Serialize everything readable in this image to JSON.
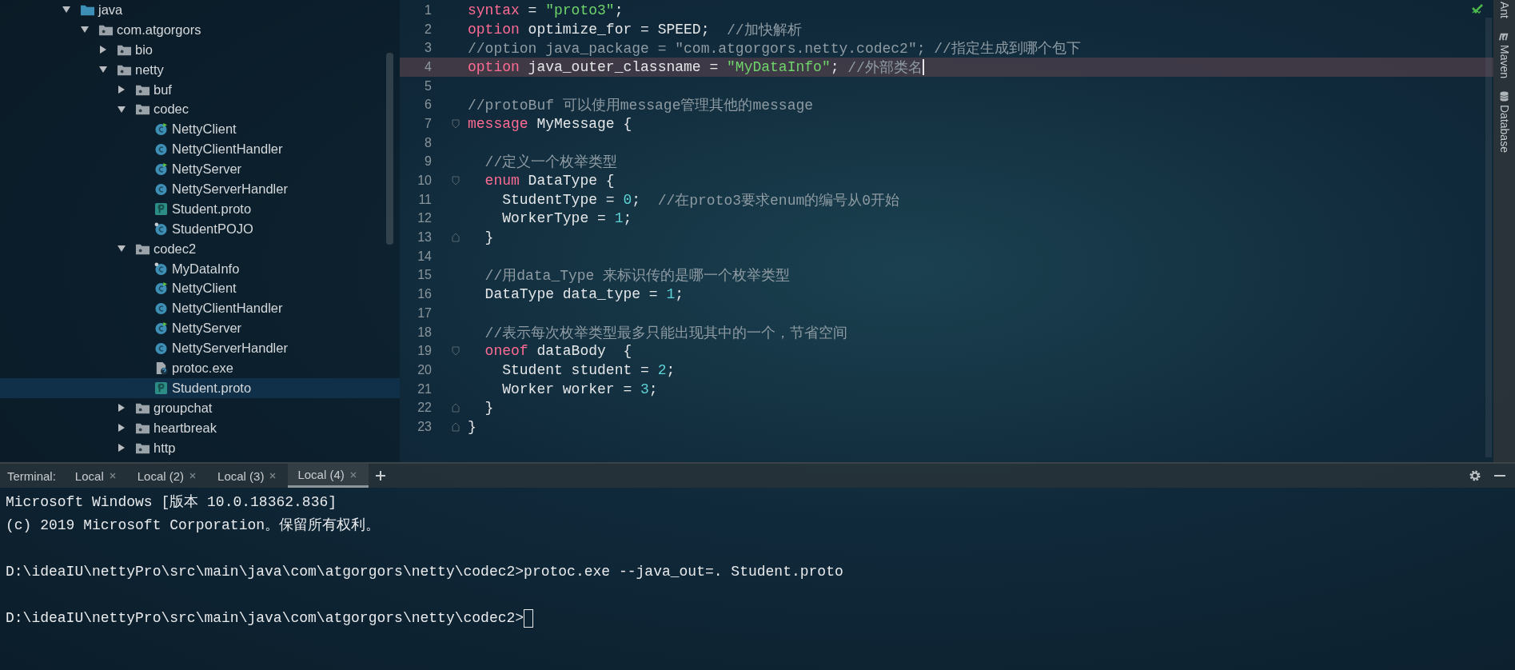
{
  "project_tree": [
    {
      "label": "java",
      "kind": "source-folder",
      "expanded": true,
      "selected": false,
      "children": [
        {
          "label": "com.atgorgors",
          "kind": "package",
          "expanded": true,
          "selected": false,
          "children": [
            {
              "label": "bio",
              "kind": "package",
              "expanded": false,
              "selected": false
            },
            {
              "label": "netty",
              "kind": "package",
              "expanded": true,
              "selected": false,
              "children": [
                {
                  "label": "buf",
                  "kind": "package",
                  "expanded": false,
                  "selected": false
                },
                {
                  "label": "codec",
                  "kind": "package",
                  "expanded": true,
                  "selected": false,
                  "children": [
                    {
                      "label": "NettyClient",
                      "kind": "runnable-class",
                      "selected": false
                    },
                    {
                      "label": "NettyClientHandler",
                      "kind": "class",
                      "selected": false
                    },
                    {
                      "label": "NettyServer",
                      "kind": "runnable-class",
                      "selected": false
                    },
                    {
                      "label": "NettyServerHandler",
                      "kind": "class",
                      "selected": false
                    },
                    {
                      "label": "Student.proto",
                      "kind": "proto",
                      "selected": false
                    },
                    {
                      "label": "StudentPOJO",
                      "kind": "generated-class",
                      "selected": false
                    }
                  ]
                },
                {
                  "label": "codec2",
                  "kind": "package",
                  "expanded": true,
                  "selected": false,
                  "children": [
                    {
                      "label": "MyDataInfo",
                      "kind": "generated-class",
                      "selected": false
                    },
                    {
                      "label": "NettyClient",
                      "kind": "runnable-class",
                      "selected": false
                    },
                    {
                      "label": "NettyClientHandler",
                      "kind": "class",
                      "selected": false
                    },
                    {
                      "label": "NettyServer",
                      "kind": "runnable-class",
                      "selected": false
                    },
                    {
                      "label": "NettyServerHandler",
                      "kind": "class",
                      "selected": false
                    },
                    {
                      "label": "protoc.exe",
                      "kind": "unknown-file",
                      "selected": false
                    },
                    {
                      "label": "Student.proto",
                      "kind": "proto",
                      "selected": true
                    }
                  ]
                },
                {
                  "label": "groupchat",
                  "kind": "package",
                  "expanded": false,
                  "selected": false
                },
                {
                  "label": "heartbreak",
                  "kind": "package",
                  "expanded": false,
                  "selected": false
                },
                {
                  "label": "http",
                  "kind": "package",
                  "expanded": false,
                  "selected": false
                }
              ]
            }
          ]
        }
      ]
    }
  ],
  "editor": {
    "lines": [
      {
        "number": "1",
        "current": false,
        "tokens": [
          {
            "kind": "keyword",
            "text": "syntax"
          },
          {
            "kind": "plain",
            "text": " = "
          },
          {
            "kind": "string",
            "text": "\"proto3\""
          },
          {
            "kind": "plain",
            "text": ";"
          }
        ]
      },
      {
        "number": "2",
        "current": false,
        "tokens": [
          {
            "kind": "keyword",
            "text": "option"
          },
          {
            "kind": "plain",
            "text": " optimize_for = SPEED;  "
          },
          {
            "kind": "comment",
            "text": "//加快解析"
          }
        ]
      },
      {
        "number": "3",
        "current": false,
        "tokens": [
          {
            "kind": "comment",
            "text": "//option java_package = \"com.atgorgors.netty.codec2\"; //指定生成到哪个包下"
          }
        ]
      },
      {
        "number": "4",
        "current": true,
        "tokens": [
          {
            "kind": "keyword",
            "text": "option"
          },
          {
            "kind": "plain",
            "text": " java_outer_classname = "
          },
          {
            "kind": "string",
            "text": "\"MyDataInfo\""
          },
          {
            "kind": "plain",
            "text": "; "
          },
          {
            "kind": "comment",
            "text": "//外部类名"
          }
        ]
      },
      {
        "number": "5",
        "current": false
      },
      {
        "number": "6",
        "current": false,
        "tokens": [
          {
            "kind": "comment",
            "text": "//protoBuf 可以使用message管理其他的message"
          }
        ]
      },
      {
        "number": "7",
        "current": false,
        "fold_start": true,
        "tokens": [
          {
            "kind": "keyword",
            "text": "message"
          },
          {
            "kind": "plain",
            "text": " MyMessage {"
          }
        ]
      },
      {
        "number": "8",
        "current": false
      },
      {
        "number": "9",
        "current": false,
        "tokens": [
          {
            "kind": "comment",
            "text": "  //定义一个枚举类型"
          }
        ]
      },
      {
        "number": "10",
        "current": false,
        "fold_start": true,
        "nested": true,
        "tokens": [
          {
            "kind": "keyword",
            "text": "enum"
          },
          {
            "kind": "plain",
            "text": " DataType {"
          }
        ]
      },
      {
        "number": "11",
        "current": false,
        "tokens": [
          {
            "kind": "plain",
            "text": "    StudentType = "
          },
          {
            "kind": "number",
            "text": "0"
          },
          {
            "kind": "plain",
            "text": ";  "
          },
          {
            "kind": "comment",
            "text": "//在proto3要求enum的编号从0开始"
          }
        ]
      },
      {
        "number": "12",
        "current": false,
        "tokens": [
          {
            "kind": "plain",
            "text": "    WorkerType = "
          },
          {
            "kind": "number",
            "text": "1"
          },
          {
            "kind": "plain",
            "text": ";"
          }
        ]
      },
      {
        "number": "13",
        "current": false,
        "fold_end": true,
        "tokens": [
          {
            "kind": "plain",
            "text": "  }"
          }
        ]
      },
      {
        "number": "14",
        "current": false
      },
      {
        "number": "15",
        "current": false,
        "tokens": [
          {
            "kind": "comment",
            "text": "  //用data_Type 来标识传的是哪一个枚举类型"
          }
        ]
      },
      {
        "number": "16",
        "current": false,
        "tokens": [
          {
            "kind": "plain",
            "text": "  DataType data_type = "
          },
          {
            "kind": "number",
            "text": "1"
          },
          {
            "kind": "plain",
            "text": ";"
          }
        ]
      },
      {
        "number": "17",
        "current": false
      },
      {
        "number": "18",
        "current": false,
        "tokens": [
          {
            "kind": "comment",
            "text": "  //表示每次枚举类型最多只能出现其中的一个，节省空间"
          }
        ]
      },
      {
        "number": "19",
        "current": false,
        "fold_start": true,
        "nested": true,
        "tokens": [
          {
            "kind": "keyword",
            "text": "oneof"
          },
          {
            "kind": "plain",
            "text": " dataBody  {"
          }
        ]
      },
      {
        "number": "20",
        "current": false,
        "tokens": [
          {
            "kind": "plain",
            "text": "    Student student = "
          },
          {
            "kind": "number",
            "text": "2"
          },
          {
            "kind": "plain",
            "text": ";"
          }
        ]
      },
      {
        "number": "21",
        "current": false,
        "tokens": [
          {
            "kind": "plain",
            "text": "    Worker worker = "
          },
          {
            "kind": "number",
            "text": "3"
          },
          {
            "kind": "plain",
            "text": ";"
          }
        ]
      },
      {
        "number": "22",
        "current": false,
        "fold_end": true,
        "tokens": [
          {
            "kind": "plain",
            "text": "  }"
          }
        ]
      },
      {
        "number": "23",
        "current": false,
        "fold_end": true,
        "tokens": [
          {
            "kind": "plain",
            "text": "}"
          }
        ]
      }
    ]
  },
  "tool_strip": [
    {
      "label": "Ant",
      "kind": "ant"
    },
    {
      "label": "Maven",
      "kind": "maven"
    },
    {
      "label": "Database",
      "kind": "database"
    }
  ],
  "terminal": {
    "label": "Terminal:",
    "tabs": [
      {
        "label": "Local",
        "selected": false
      },
      {
        "label": "Local (2)",
        "selected": false
      },
      {
        "label": "Local (3)",
        "selected": false
      },
      {
        "label": "Local (4)",
        "selected": true
      }
    ],
    "blocks": [
      [
        "Microsoft Windows [版本 10.0.18362.836]",
        "(c) 2019 Microsoft Corporation。保留所有权利。"
      ],
      [
        "D:\\ideaIU\\nettyPro\\src\\main\\java\\com\\atgorgors\\netty\\codec2>protoc.exe --java_out=. Student.proto"
      ],
      [
        "D:\\ideaIU\\nettyPro\\src\\main\\java\\com\\atgorgors\\netty\\codec2>"
      ]
    ],
    "cursor": true
  }
}
